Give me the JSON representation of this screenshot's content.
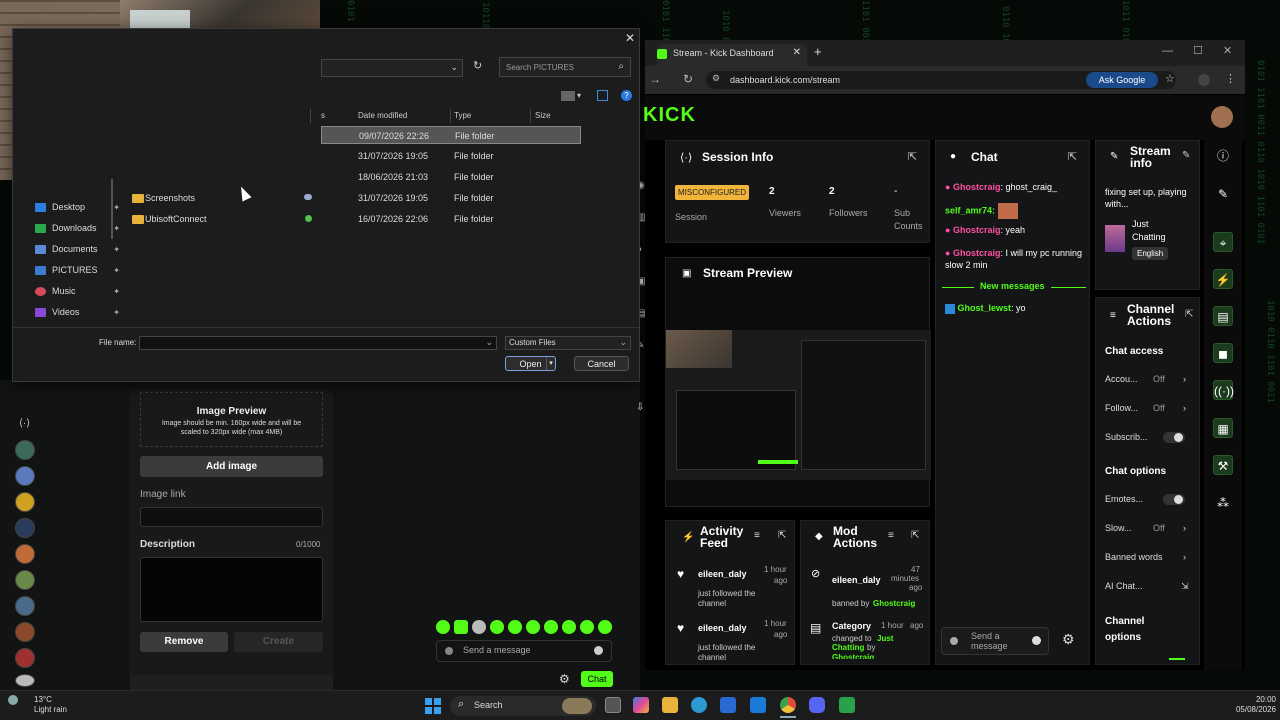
{
  "file_dialog": {
    "search_placeholder": "Search PICTURES",
    "columns": [
      "Date modified",
      "Type",
      "Size"
    ],
    "col_status_fragment": "s",
    "rows": [
      {
        "name": "",
        "date": "09/07/2026 22:26",
        "type": "File folder",
        "status": "",
        "selected": true
      },
      {
        "name": "",
        "date": "31/07/2026 19:05",
        "type": "File folder",
        "status": ""
      },
      {
        "name": "",
        "date": "18/06/2026 21:03",
        "type": "File folder",
        "status": ""
      },
      {
        "name": "Screenshots",
        "date": "31/07/2026 19:05",
        "type": "File folder",
        "status": "cloud"
      },
      {
        "name": "UbisoftConnect",
        "date": "16/07/2026 22:06",
        "type": "File folder",
        "status": "synced"
      }
    ],
    "sidebar": [
      {
        "label": "Desktop",
        "color": "#2a7de1"
      },
      {
        "label": "Downloads",
        "color": "#2aa84a"
      },
      {
        "label": "Documents",
        "color": "#5a8ad8"
      },
      {
        "label": "PICTURES",
        "color": "#3a7ad0"
      },
      {
        "label": "Music",
        "color": "#d84a5a"
      },
      {
        "label": "Videos",
        "color": "#8a4ad8"
      }
    ],
    "file_name_label": "File name:",
    "file_name_value": "",
    "file_type": "Custom Files",
    "open_label": "Open",
    "cancel_label": "Cancel"
  },
  "left_form": {
    "image_preview_title": "Image Preview",
    "image_preview_note": "Image should be min. 160px wide and will be scaled to 320px wide (max 4MB)",
    "add_image": "Add image",
    "image_link_label": "Image link",
    "description_label": "Description",
    "description_count": "0/1000",
    "remove": "Remove",
    "create": "Create",
    "send_message_placeholder": "Send a message",
    "chat_button": "Chat"
  },
  "browser": {
    "tab_title": "Stream - Kick Dashboard",
    "url": "dashboard.kick.com/stream",
    "ask_google": "Ask Google",
    "logo": "KICK"
  },
  "session_info": {
    "title": "Session Info",
    "status": "MISCONFIGURED",
    "status_label": "Session",
    "viewers": "2",
    "viewers_label": "Viewers",
    "followers": "2",
    "followers_label": "Followers",
    "subs": "-",
    "subs_label_1": "Sub",
    "subs_label_2": "Counts"
  },
  "stream_preview": {
    "title": "Stream Preview"
  },
  "chat": {
    "title": "Chat",
    "messages": [
      {
        "user": "Ghostcraig",
        "text": ": ghost_craig_",
        "user_color": "#ff4fa3"
      },
      {
        "user": "self_amr74:",
        "text": "",
        "user_color": "#53fc18"
      },
      {
        "user": "Ghostcraig",
        "text": ": yeah",
        "user_color": "#ff4fa3"
      },
      {
        "user": "Ghostcraig",
        "text": ": I will my pc running slow 2 min",
        "user_color": "#ff4fa3"
      }
    ],
    "new_messages": "New messages",
    "new_msg": {
      "user": "Ghost_lewst",
      "text": ": yo",
      "user_color": "#53fc18"
    },
    "input_placeholder_1": "Send a",
    "input_placeholder_2": "message"
  },
  "stream_info": {
    "title_1": "Stream",
    "title_2": "info",
    "stream_title": "fixing set up, playing with...",
    "category_1": "Just",
    "category_2": "Chatting",
    "language": "English"
  },
  "channel_actions": {
    "title_1": "Channel",
    "title_2": "Actions",
    "chat_access": "Chat access",
    "account": "Accou...",
    "account_val": "Off",
    "follow": "Follow...",
    "follow_val": "Off",
    "subscrib": "Subscrib...",
    "chat_options": "Chat options",
    "emotes": "Emotes...",
    "slow": "Slow...",
    "slow_val": "Off",
    "banned_words": "Banned words",
    "ai_chat": "AI Chat...",
    "channel_options_1": "Channel",
    "channel_options_2": "options"
  },
  "activity_feed": {
    "title_1": "Activity",
    "title_2": "Feed",
    "items": [
      {
        "user": "eileen_daly",
        "time_1": "1 hour",
        "time_2": "ago",
        "text_1": "just followed the",
        "text_2": "channel"
      },
      {
        "user": "eileen_daly",
        "time_1": "1 hour",
        "time_2": "ago",
        "text_1": "just followed the",
        "text_2": "channel"
      }
    ]
  },
  "mod_actions": {
    "title_1": "Mod",
    "title_2": "Actions",
    "item1": {
      "user": "eileen_daly",
      "time_1": "47",
      "time_2": "minutes",
      "time_3": "ago",
      "text": "banned by",
      "by": "Ghostcraig"
    },
    "item2": {
      "user": "Category",
      "time_1": "1 hour",
      "time_2": "ago",
      "text": "changed to",
      "cat_1": "Just",
      "cat_2": "Chatting",
      "by_prefix": "by",
      "by": "Ghostcraig"
    }
  },
  "taskbar": {
    "weather_temp": "13°C",
    "weather_desc": "Light rain",
    "search": "Search",
    "time": "20:00",
    "date": "05/08/2026"
  },
  "colors": {
    "kick_green": "#53fc18",
    "misconfigured": "#f0b53a",
    "chat_pink": "#ff4fa3"
  }
}
